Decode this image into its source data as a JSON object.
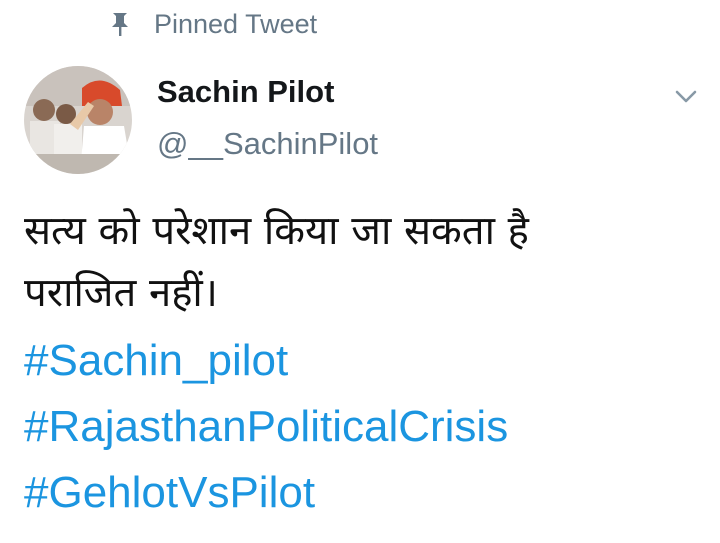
{
  "pinned": {
    "label": "Pinned Tweet",
    "icon": "pin-icon"
  },
  "author": {
    "name": "Sachin Pilot",
    "handle": "@__SachinPilot",
    "avatar": "avatar"
  },
  "menu": {
    "icon": "chevron-down-icon"
  },
  "tweet": {
    "lines": [
      "सत्य को परेशान किया जा सकता है",
      "पराजित नहीं।"
    ],
    "hashtags": [
      "#Sachin_pilot",
      "#RajasthanPoliticalCrisis",
      "#GehlotVsPilot"
    ]
  },
  "colors": {
    "name": "#14171a",
    "secondary": "#657786",
    "link": "#1b95e0",
    "text": "#111111"
  }
}
